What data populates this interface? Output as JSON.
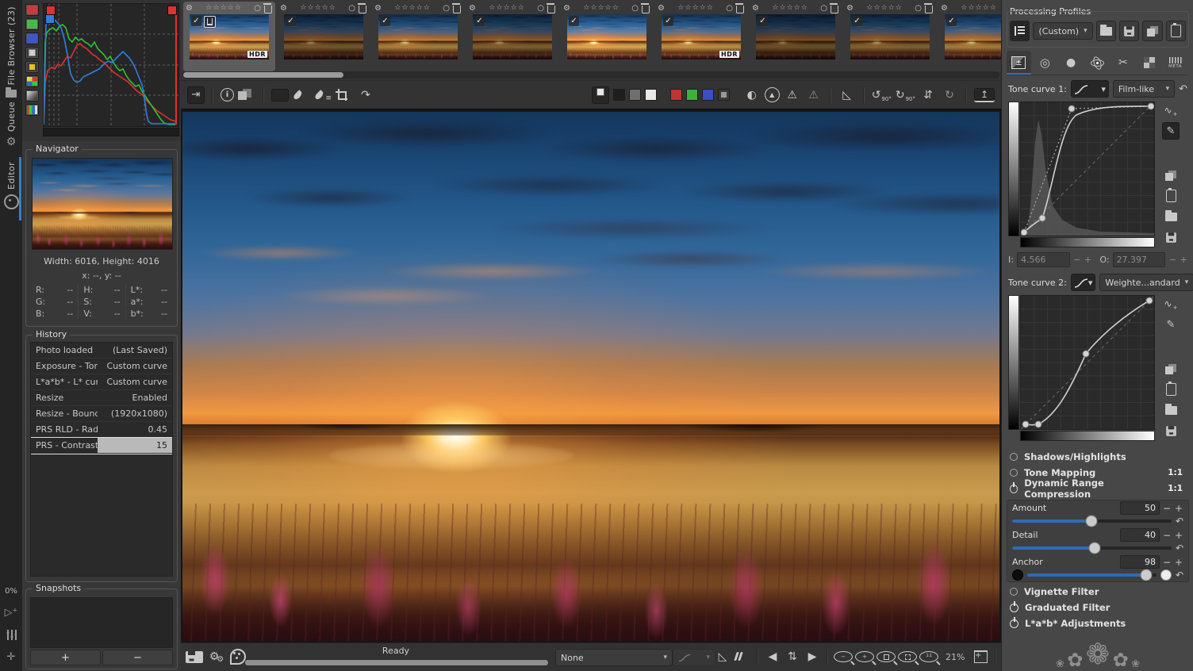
{
  "icons": {
    "gear": "⚙",
    "star": "☆",
    "check": "✓",
    "caret": "▾",
    "reset": "↶",
    "minus": "−",
    "plus": "+",
    "circle_label": "○",
    "flower_small": "❀",
    "flower_mid": "✿",
    "flower_big": "❁"
  },
  "left_rail": {
    "tabs": [
      {
        "label": "File Browser (23)",
        "icon": "folder-icon"
      },
      {
        "label": "Queue",
        "icon": "gears-icon"
      },
      {
        "label": "Editor",
        "icon": "aperture-icon",
        "active": true
      }
    ],
    "zoom_label": "0%"
  },
  "navigator": {
    "title": "Navigator",
    "size": "Width: 6016, Height: 4016",
    "position": "x: --, y: --",
    "values": [
      {
        "label": "R:",
        "value": "--"
      },
      {
        "label": "H:",
        "value": "--"
      },
      {
        "label": "L*:",
        "value": "--"
      },
      {
        "label": "G:",
        "value": "--"
      },
      {
        "label": "S:",
        "value": "--"
      },
      {
        "label": "a*:",
        "value": "--"
      },
      {
        "label": "B:",
        "value": "--"
      },
      {
        "label": "V:",
        "value": "--"
      },
      {
        "label": "b*:",
        "value": "--"
      }
    ]
  },
  "history": {
    "title": "History",
    "rows": [
      {
        "label": "Photo loaded",
        "value": "(Last Saved)"
      },
      {
        "label": "Exposure - Tone c...",
        "value": "Custom curve"
      },
      {
        "label": "L*a*b* - L* curve",
        "value": "Custom curve"
      },
      {
        "label": "Resize",
        "value": "Enabled"
      },
      {
        "label": "Resize - Bounding...",
        "value": "(1920x1080)"
      },
      {
        "label": "PRS RLD - Radius",
        "value": "0.45"
      },
      {
        "label": "PRS - Contrast thr...",
        "value": "15",
        "selected": true
      }
    ]
  },
  "snapshots": {
    "title": "Snapshots",
    "add_label": "+",
    "remove_label": "−"
  },
  "filmstrip": {
    "hdr_label": "HDR",
    "thumbs": [
      {
        "selected": true,
        "checked": true,
        "saved": true,
        "hdr": true,
        "brightness": 1
      },
      {
        "checked": true,
        "brightness": 0.55
      },
      {
        "checked": true,
        "brightness": 0.8
      },
      {
        "checked": true,
        "brightness": 0.6
      },
      {
        "checked": true,
        "brightness": 1.05
      },
      {
        "checked": true,
        "hdr": true,
        "brightness": 0.9
      },
      {
        "checked": true,
        "brightness": 0.5
      },
      {
        "checked": true,
        "brightness": 0.62
      },
      {
        "checked": true,
        "brightness": 0.78
      },
      {
        "checked": true,
        "brightness": 0.7
      }
    ]
  },
  "edit_toolbar": {
    "left": [
      {
        "n": "dock-left-panel-button",
        "c": "ic-collapse",
        "g": "⇥",
        "p": true
      },
      "|",
      {
        "n": "image-info-button",
        "c": "ic-info",
        "g": "i"
      },
      {
        "n": "before-after-view-button",
        "c": "ic-beforeafter"
      },
      "|",
      {
        "n": "hand-tool-button",
        "c": "ic-hand",
        "p": true
      },
      {
        "n": "white-balance-picker-button",
        "c": "ic-dropper"
      },
      {
        "n": "color-picker-button",
        "c": "ic-dropper ic-dropper2"
      },
      {
        "n": "crop-tool-button",
        "c": "ic-crop"
      },
      {
        "n": "straighten-tool-button",
        "g": "↷"
      }
    ],
    "right": [
      {
        "n": "background-color-original-button",
        "c": "ic-bg",
        "p": true
      },
      {
        "n": "background-black-button",
        "c": "ic-sq ic-sq-dark"
      },
      {
        "n": "background-gray-button",
        "c": "ic-sq ic-sq-mid"
      },
      {
        "n": "background-white-button",
        "c": "ic-sq ic-sq-white"
      },
      "·",
      {
        "n": "channel-red-button",
        "c": "ic-sq ic-ch-r"
      },
      {
        "n": "channel-green-button",
        "c": "ic-sq ic-ch-g"
      },
      {
        "n": "channel-blue-button",
        "c": "ic-sq ic-ch-b"
      },
      {
        "n": "channel-luminosity-button",
        "c": "ic-sq ic-ch-l"
      },
      "·",
      {
        "n": "black-white-preview-button",
        "g": "◐"
      },
      {
        "n": "focus-mask-button",
        "c": "ic-circtri",
        "g": "▲"
      },
      {
        "n": "highlight-clipping-button",
        "g": "⚠"
      },
      {
        "n": "shadow-clipping-button",
        "g": "⚠",
        "d": true
      },
      "|",
      {
        "n": "sharpening-mask-button",
        "g": "◺"
      },
      "|",
      {
        "n": "rotate-ccw-90-button",
        "g": "↺",
        "s": "90°"
      },
      {
        "n": "rotate-cw-90-button",
        "g": "↻",
        "s": "90°"
      },
      {
        "n": "flip-vertical-button",
        "g": "⇵"
      },
      {
        "n": "free-rotate-button",
        "g": "↻",
        "d": true
      },
      "|",
      {
        "n": "pin-panel-button",
        "c": "ic-pin",
        "g": "↥",
        "p": true
      }
    ]
  },
  "statusbar": {
    "ready": "Ready",
    "preview_mode": "None",
    "zoom": "21%",
    "icons": [
      {
        "n": "save-image-button",
        "c": "i-floppy"
      },
      {
        "n": "batch-settings-button",
        "c": "ic-gears",
        "g": "⚙",
        "s": "⚙"
      },
      {
        "n": "send-to-editor-button",
        "c": "ic-palette"
      }
    ],
    "right_icons": [
      {
        "n": "soft-proofing-button",
        "g": "◺"
      },
      {
        "n": "gamut-check-button",
        "c": "ic-gamut"
      },
      "|",
      {
        "n": "previous-image-button",
        "g": "◀"
      },
      {
        "n": "sync-filmstrip-button",
        "g": "⇅"
      },
      {
        "n": "next-image-button",
        "g": "▶"
      },
      "|",
      {
        "n": "zoom-out-button",
        "c": "mag",
        "g": "−"
      },
      {
        "n": "zoom-in-button",
        "c": "mag",
        "g": "+"
      },
      {
        "n": "zoom-fit-button",
        "c": "mag",
        "fit": true
      },
      {
        "n": "zoom-fit-crop-button",
        "c": "mag",
        "crop": true
      },
      {
        "n": "zoom-100-button",
        "c": "mag",
        "g11": "1:1"
      }
    ]
  },
  "profiles": {
    "title": "Processing Profiles",
    "selected": "(Custom)"
  },
  "tools": {
    "tone_curve_1": {
      "label": "Tone curve 1:",
      "mode": "Film-like",
      "input_label": "I:",
      "input_value": "4.566",
      "output_label": "O:",
      "output_value": "27.397"
    },
    "tone_curve_2": {
      "label": "Tone curve 2:",
      "mode": "Weighte...andard"
    },
    "sections_a": [
      {
        "label": "Shadows/Highlights",
        "type": "circle"
      },
      {
        "label": "Tone Mapping",
        "type": "circle",
        "badge": "1:1"
      },
      {
        "label": "Dynamic Range Compression",
        "type": "power",
        "badge": "1:1"
      }
    ],
    "drc": {
      "sliders": [
        {
          "label": "Amount",
          "value": "50",
          "fill": 50
        },
        {
          "label": "Detail",
          "value": "40",
          "fill": 52
        },
        {
          "label": "Anchor",
          "value": "98",
          "fill": 92,
          "dots": true
        }
      ]
    },
    "sections_b": [
      {
        "label": "Vignette Filter",
        "type": "circle"
      },
      {
        "label": "Graduated Filter",
        "type": "power"
      },
      {
        "label": "L*a*b* Adjustments",
        "type": "power"
      }
    ]
  }
}
